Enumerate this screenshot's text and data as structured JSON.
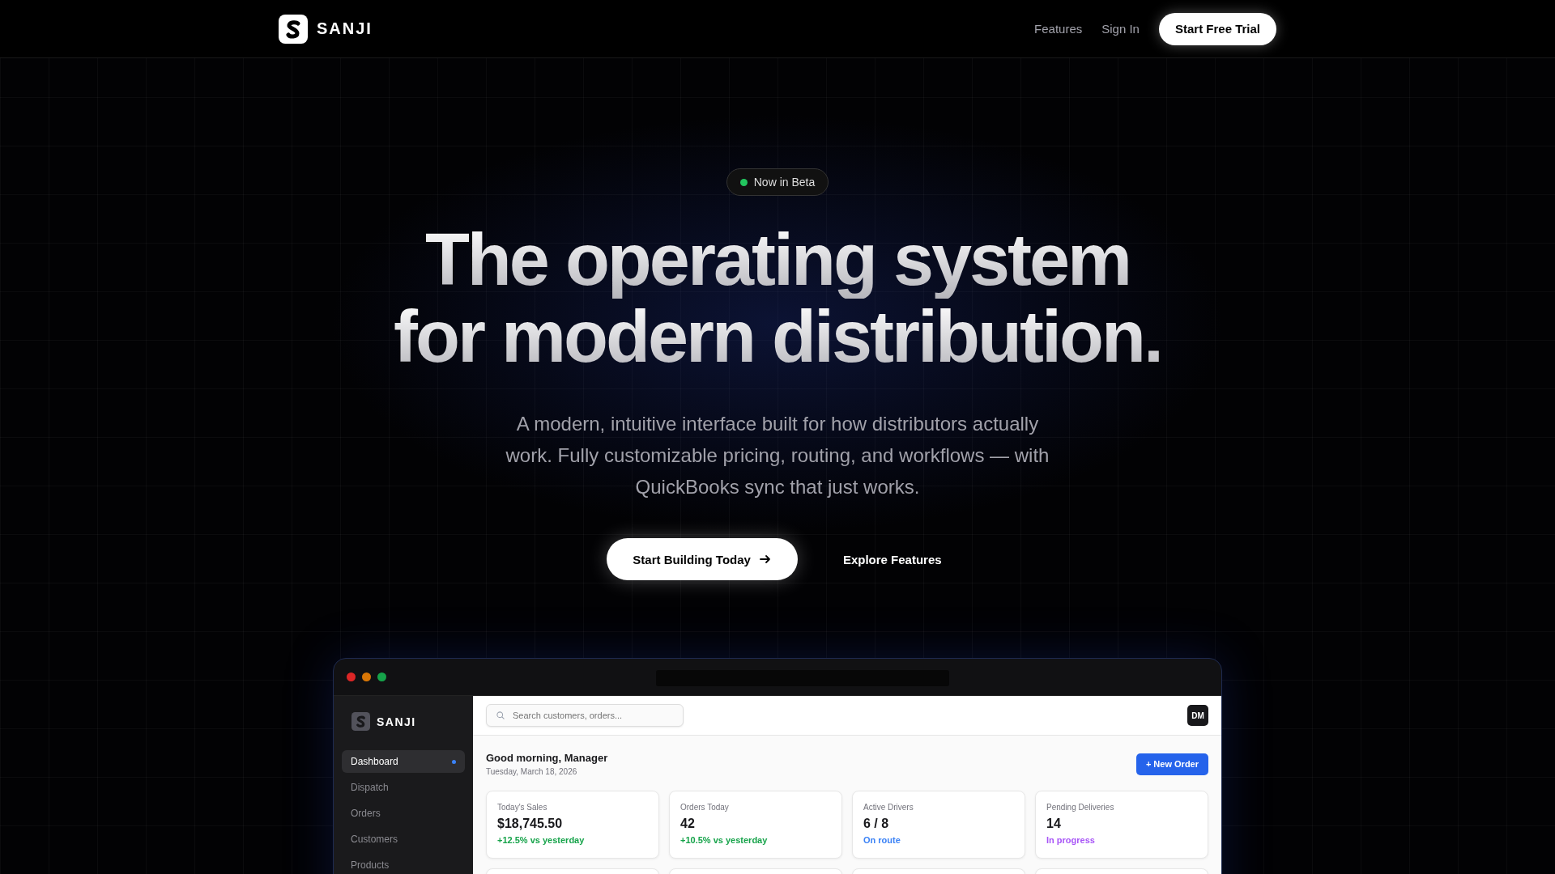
{
  "nav": {
    "brand": "SANJI",
    "links": [
      "Features",
      "Sign In"
    ],
    "cta": "Start Free Trial"
  },
  "hero": {
    "badge": "Now in Beta",
    "title_lines": [
      "The operating system",
      "for modern distribution."
    ],
    "subtitle": "A modern, intuitive interface built for how distributors actually work. Fully customizable pricing, routing, and workflows — with QuickBooks sync that just works.",
    "primary_button": "Start Building Today",
    "secondary_button": "Explore Features"
  },
  "app": {
    "brand": "SANJI",
    "search": {
      "placeholder": "Search customers, orders..."
    },
    "avatar": "DM",
    "sidebar": [
      {
        "label": "Dashboard",
        "selected": true
      },
      {
        "label": "Dispatch",
        "selected": false
      },
      {
        "label": "Orders",
        "selected": false
      },
      {
        "label": "Customers",
        "selected": false
      },
      {
        "label": "Products",
        "selected": false
      }
    ],
    "greeting": "Good morning, Manager",
    "date": "Tuesday, March 18, 2026",
    "new_order": "+ New Order",
    "stats": [
      {
        "label": "Today's Sales",
        "value": "$18,745.50",
        "note": "+12.5% vs yesterday",
        "color": "#16a34a"
      },
      {
        "label": "Orders Today",
        "value": "42",
        "note": "+10.5% vs yesterday",
        "color": "#16a34a"
      },
      {
        "label": "Active Drivers",
        "value": "6 / 8",
        "note": "On route",
        "color": "#3b82f6"
      },
      {
        "label": "Pending Deliveries",
        "value": "14",
        "note": "In progress",
        "color": "#a855f7"
      }
    ]
  }
}
